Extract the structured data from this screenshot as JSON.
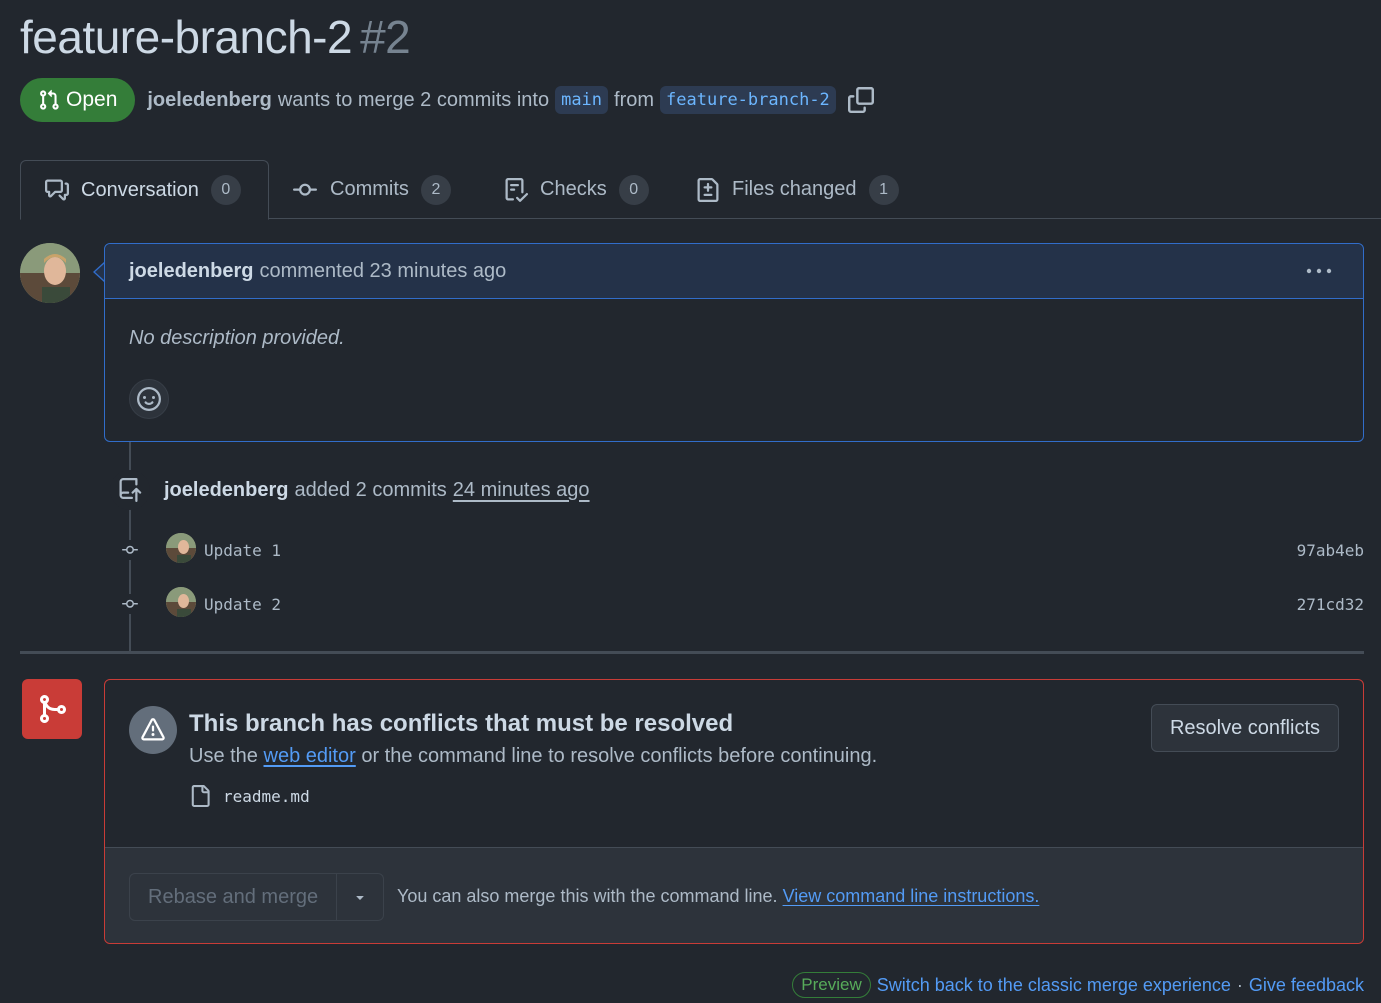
{
  "pr": {
    "title": "feature-branch-2",
    "number": "#2",
    "state": "Open",
    "author": "joeledenberg",
    "merge_text": "wants to merge 2 commits into",
    "base_branch": "main",
    "from_text": "from",
    "head_branch": "feature-branch-2"
  },
  "tabs": [
    {
      "label": "Conversation",
      "count": "0",
      "icon": "comment-discussion-icon"
    },
    {
      "label": "Commits",
      "count": "2",
      "icon": "git-commit-icon"
    },
    {
      "label": "Checks",
      "count": "0",
      "icon": "checklist-icon"
    },
    {
      "label": "Files changed",
      "count": "1",
      "icon": "file-diff-icon"
    }
  ],
  "comment": {
    "author": "joeledenberg",
    "action": "commented 23 minutes ago",
    "body": "No description provided."
  },
  "timeline": {
    "author": "joeledenberg",
    "action": "added 2 commits",
    "time": "24 minutes ago",
    "commits": [
      {
        "message": "Update 1",
        "sha": "97ab4eb"
      },
      {
        "message": "Update 2",
        "sha": "271cd32"
      }
    ]
  },
  "merge": {
    "conflict_title": "This branch has conflicts that must be resolved",
    "sub_prefix": "Use the",
    "web_editor_link": "web editor",
    "sub_suffix": "or the command line to resolve conflicts before continuing.",
    "conflict_file": "readme.md",
    "resolve_button": "Resolve conflicts",
    "merge_button": "Rebase and merge",
    "hint_text": "You can also merge this with the command line.",
    "hint_link": "View command line instructions."
  },
  "footer": {
    "preview_badge": "Preview",
    "switch_link": "Switch back to the classic merge experience",
    "separator": "·",
    "feedback_link": "Give feedback"
  },
  "colors": {
    "background": "#22272e",
    "open_green": "#347d39",
    "conflict_red": "#c93c37",
    "link_blue": "#539bf5"
  }
}
